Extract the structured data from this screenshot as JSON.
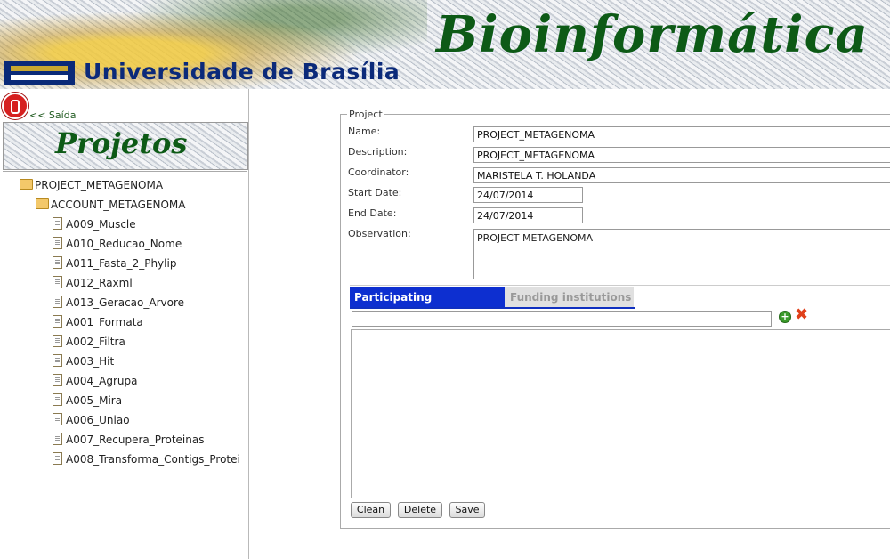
{
  "header": {
    "university": "Universidade de Brasília",
    "site_title": "Bioinformática"
  },
  "sidebar": {
    "exit_label": "<< Saída",
    "panel_title": "Projetos",
    "tree": {
      "project": "PROJECT_METAGENOMA",
      "account": "ACCOUNT_METAGENOMA",
      "activities": [
        "A009_Muscle",
        "A010_Reducao_Nome",
        "A011_Fasta_2_Phylip",
        "A012_Raxml",
        "A013_Geracao_Arvore",
        "A001_Formata",
        "A002_Filtra",
        "A003_Hit",
        "A004_Agrupa",
        "A005_Mira",
        "A006_Uniao",
        "A007_Recupera_Proteinas",
        "A008_Transforma_Contigs_Protei"
      ]
    }
  },
  "form": {
    "legend": "Project",
    "name_label": "Name:",
    "name_value": "PROJECT_METAGENOMA",
    "description_label": "Description:",
    "description_value": "PROJECT_METAGENOMA",
    "coordinator_label": "Coordinator:",
    "coordinator_value": "MARISTELA T. HOLANDA",
    "start_label": "Start Date:",
    "start_value": "24/07/2014",
    "end_label": "End Date:",
    "end_value": "24/07/2014",
    "observation_label": "Observation:",
    "observation_value": "PROJECT METAGENOMA",
    "tabs": [
      "Participating institutions",
      "Funding institutions"
    ],
    "institution_input": "",
    "buttons": {
      "clean": "Clean",
      "delete": "Delete",
      "save": "Save"
    }
  },
  "colors": {
    "brand_green": "#0d5a16",
    "brand_blue": "#0b2a7a",
    "tab_active": "#0d2fd0"
  }
}
